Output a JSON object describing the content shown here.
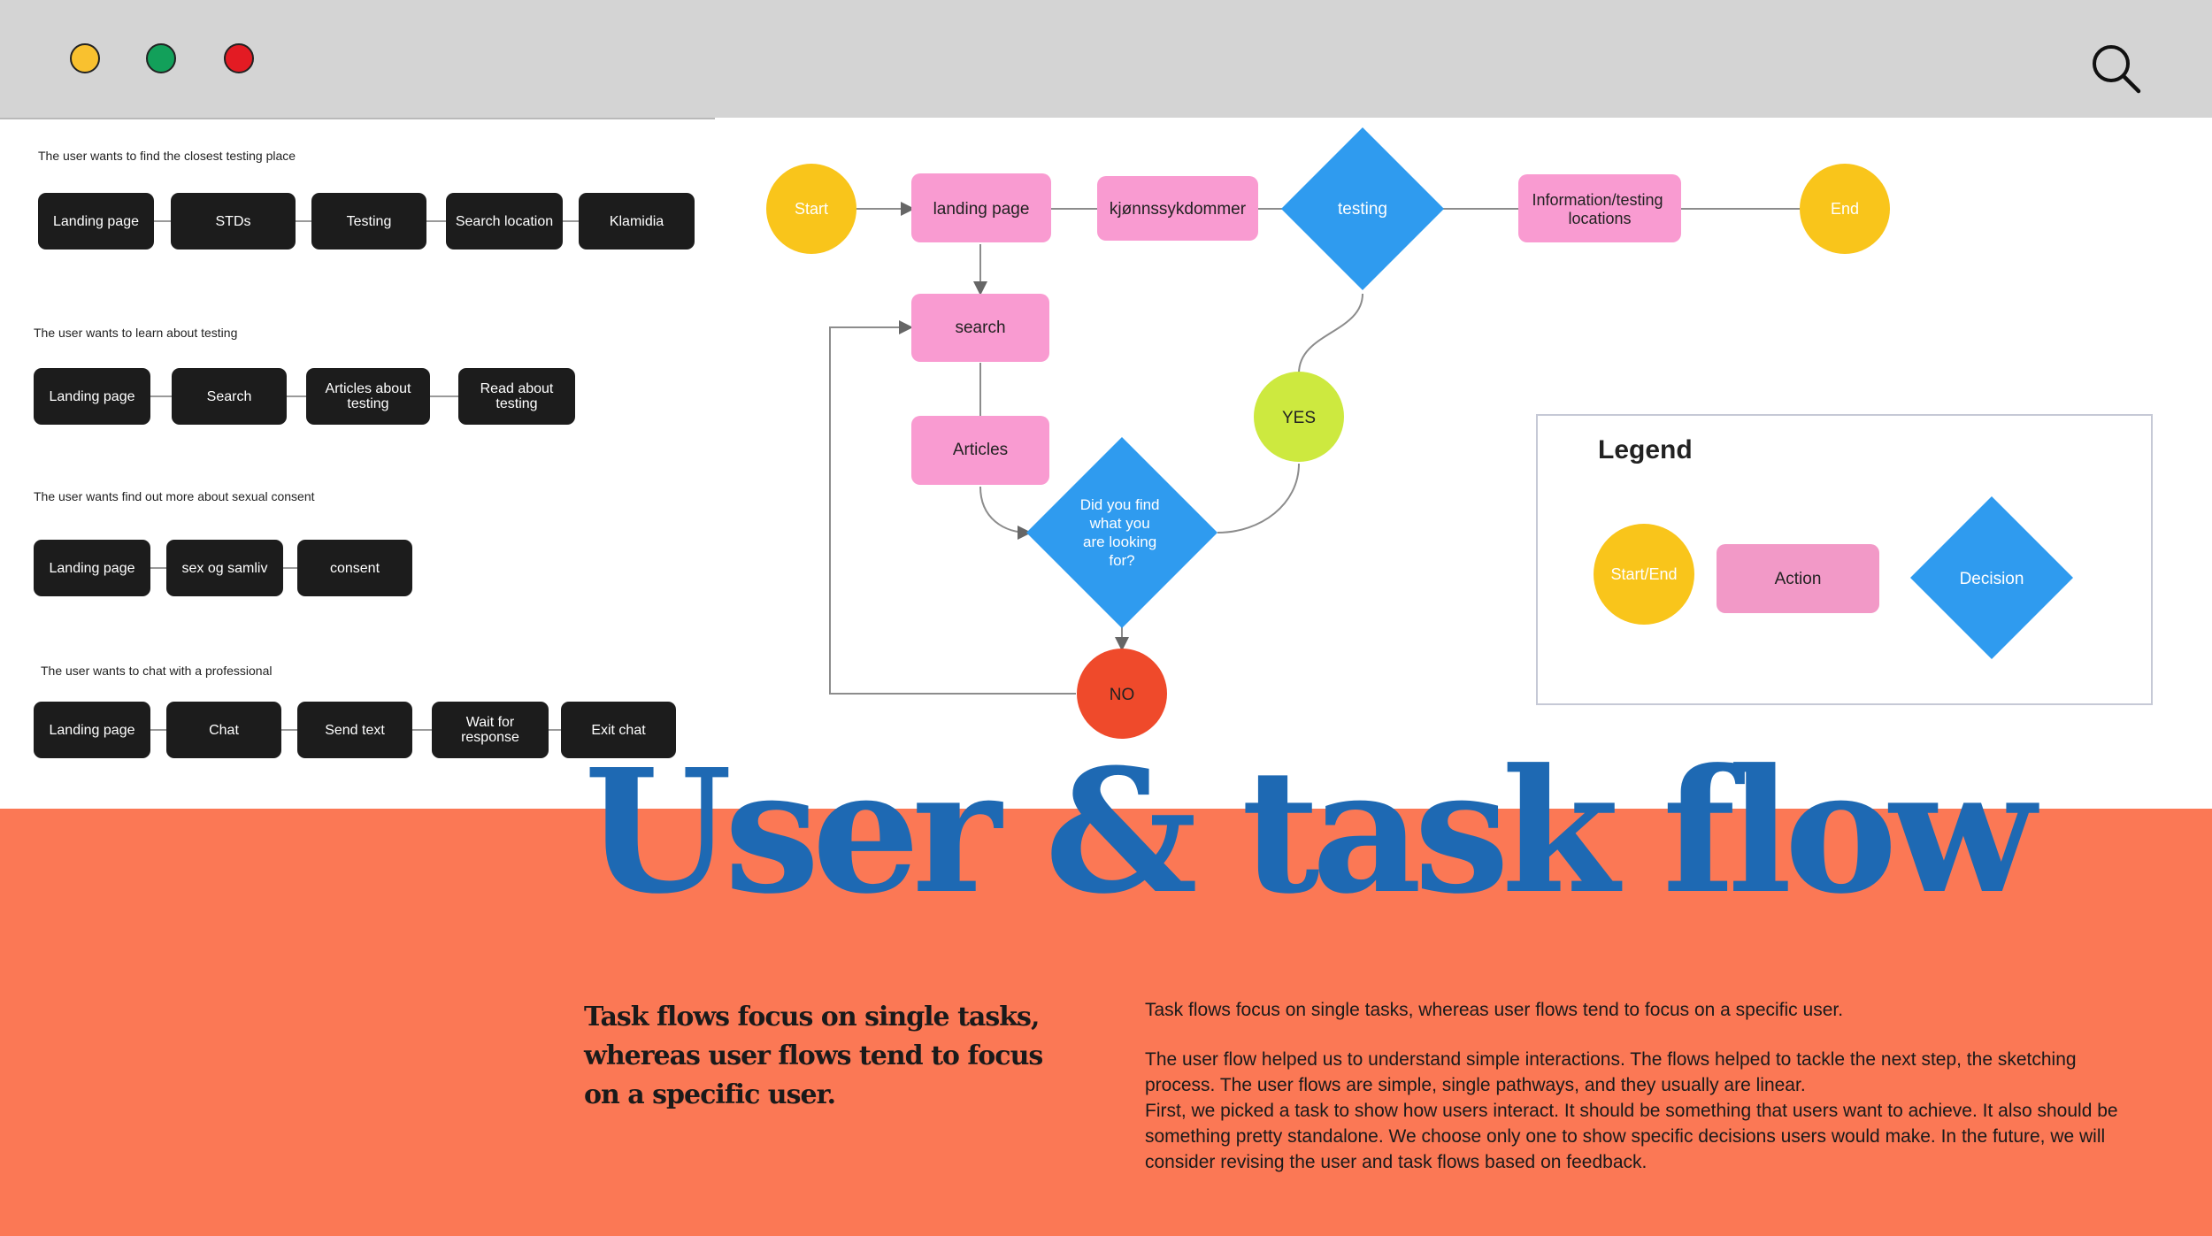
{
  "window": {
    "traffic_lights": [
      {
        "name": "yellow",
        "color": "#f9c12f"
      },
      {
        "name": "green",
        "color": "#12a05a"
      },
      {
        "name": "red",
        "color": "#e31b23"
      }
    ],
    "search_icon": "search-icon"
  },
  "task_flows": [
    {
      "caption": "The user wants to find the closest testing place",
      "steps": [
        "Landing page",
        "STDs",
        "Testing",
        "Search location",
        "Klamidia"
      ]
    },
    {
      "caption": "The user wants to learn about testing",
      "steps": [
        "Landing page",
        "Search",
        "Articles about testing",
        "Read about testing"
      ]
    },
    {
      "caption": "The user wants find out more about sexual consent",
      "steps": [
        "Landing page",
        "sex og samliv",
        "consent"
      ]
    },
    {
      "caption": "The user wants to chat with a professional",
      "steps": [
        "Landing page",
        "Chat",
        "Send text",
        "Wait for response",
        "Exit chat"
      ]
    }
  ],
  "user_flow": {
    "nodes": {
      "start": {
        "label": "Start",
        "kind": "start-end"
      },
      "landing": {
        "label": "landing page",
        "kind": "action"
      },
      "kjonn": {
        "label": "kjønnssykdommer",
        "kind": "action"
      },
      "testing": {
        "label": "testing",
        "kind": "decision"
      },
      "info": {
        "label": "Information/testing locations",
        "kind": "action"
      },
      "end": {
        "label": "End",
        "kind": "start-end"
      },
      "search": {
        "label": "search",
        "kind": "action"
      },
      "articles": {
        "label": "Articles",
        "kind": "action"
      },
      "decision": {
        "label": "Did you find what you are looking for?",
        "kind": "decision"
      },
      "yes": {
        "label": "YES",
        "kind": "yes"
      },
      "no": {
        "label": "NO",
        "kind": "no"
      }
    },
    "colors": {
      "start_end": "#f9c51b",
      "action": "#f99bd1",
      "decision": "#2f9bef",
      "yes": "#cde93f",
      "no": "#ef4a2b"
    }
  },
  "legend": {
    "title": "Legend",
    "items": [
      {
        "label": "Start/End",
        "kind": "start-end"
      },
      {
        "label": "Action",
        "kind": "action"
      },
      {
        "label": "Decision",
        "kind": "decision"
      }
    ]
  },
  "title": "User  & task flow",
  "subheading": "Task flows focus on single tasks, whereas user flows tend to focus on a specific user.",
  "paragraphs": [
    "Task flows focus on single tasks, whereas user flows tend to focus on a specific user.",
    "The user flow helped us to understand simple interactions. The flows helped to tackle the next step, the sketching process. The user flows are simple, single pathways, and they usually are linear.",
    "First, we picked a task to show how users interact. It should be something that users want to achieve. It also should be something pretty standalone. We choose only one to show specific decisions users would make. In the future, we will consider revising the user and task flows based on feedback."
  ],
  "colors": {
    "bottom_bg": "#fb7855",
    "title": "#1e69b3",
    "task_box": "#1c1c1c"
  }
}
